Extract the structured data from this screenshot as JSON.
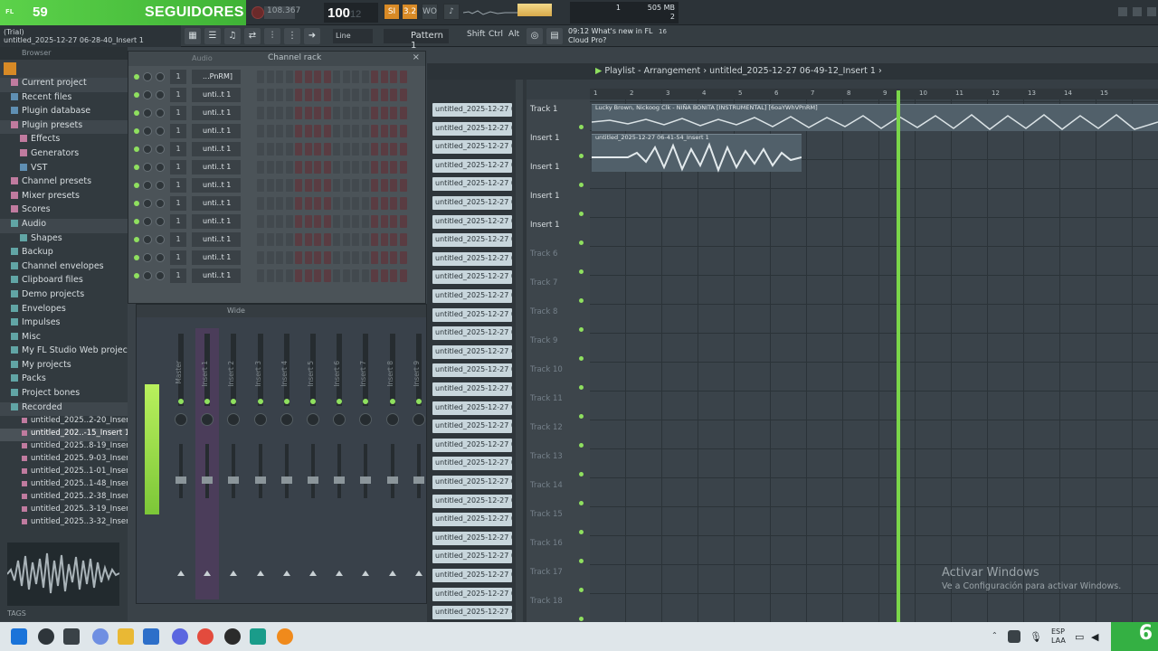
{
  "overlay": {
    "number": "59",
    "label": "SEGUIDORES",
    "app_badge": "FL"
  },
  "toolbar": {
    "tempo": "108.367",
    "time_main": "100",
    "time_sub": "12",
    "buttons": [
      "SI",
      "3.2",
      "WO"
    ],
    "cpu_value": "1",
    "memory": "505 MB",
    "voices": "2"
  },
  "hint": {
    "line1": "(Trial)",
    "line2": "untitled_2025-12-27 06-28-40_Insert 1"
  },
  "bar2": {
    "snap": "Line",
    "pattern": "Pattern 1",
    "modifiers": [
      "Shift",
      "Ctrl",
      "Alt"
    ],
    "news_time": "09:12",
    "news_line1": "What's new in FL",
    "news_line2": "Cloud Pro?",
    "news_badge": "16"
  },
  "browser": {
    "header": "Browser",
    "items": [
      {
        "label": "Current project",
        "cls": "hl",
        "icon": "pink"
      },
      {
        "label": "Recent files",
        "cls": "",
        "icon": "blue"
      },
      {
        "label": "Plugin database",
        "cls": "",
        "icon": "blue"
      },
      {
        "label": "Plugin presets",
        "cls": "hl",
        "icon": "pink"
      },
      {
        "label": "Effects",
        "cls": "sub",
        "icon": "pink"
      },
      {
        "label": "Generators",
        "cls": "sub",
        "icon": "pink"
      },
      {
        "label": "VST",
        "cls": "sub",
        "icon": "blue"
      },
      {
        "label": "Channel presets",
        "cls": "",
        "icon": "pink"
      },
      {
        "label": "Mixer presets",
        "cls": "",
        "icon": "pink"
      },
      {
        "label": "Scores",
        "cls": "",
        "icon": "pink"
      },
      {
        "label": "Audio",
        "cls": "hl",
        "icon": "teal"
      },
      {
        "label": "Shapes",
        "cls": "sub",
        "icon": "teal"
      },
      {
        "label": "Backup",
        "cls": "",
        "icon": "teal"
      },
      {
        "label": "Channel envelopes",
        "cls": "",
        "icon": "teal"
      },
      {
        "label": "Clipboard files",
        "cls": "",
        "icon": "teal"
      },
      {
        "label": "Demo projects",
        "cls": "",
        "icon": "teal"
      },
      {
        "label": "Envelopes",
        "cls": "",
        "icon": "teal"
      },
      {
        "label": "Impulses",
        "cls": "",
        "icon": "teal"
      },
      {
        "label": "Misc",
        "cls": "",
        "icon": "teal"
      },
      {
        "label": "My FL Studio Web projects",
        "cls": "",
        "icon": "teal"
      },
      {
        "label": "My projects",
        "cls": "",
        "icon": "teal"
      },
      {
        "label": "Packs",
        "cls": "",
        "icon": "teal"
      },
      {
        "label": "Project bones",
        "cls": "",
        "icon": "teal"
      },
      {
        "label": "Recorded",
        "cls": "hl",
        "icon": "teal"
      }
    ],
    "recorded": [
      {
        "label": "untitled_2025..2-20_Insert 1",
        "sel": false
      },
      {
        "label": "untitled_202..-15_Insert 1",
        "sel": true
      },
      {
        "label": "untitled_2025..8-19_Insert 1",
        "sel": false
      },
      {
        "label": "untitled_2025..9-03_Insert 1",
        "sel": false
      },
      {
        "label": "untitled_2025..1-01_Insert 1",
        "sel": false
      },
      {
        "label": "untitled_2025..1-48_Insert 1",
        "sel": false
      },
      {
        "label": "untitled_2025..2-38_Insert 1",
        "sel": false
      },
      {
        "label": "untitled_2025..3-19_Insert 1",
        "sel": false
      },
      {
        "label": "untitled_2025..3-32_Insert 1",
        "sel": false
      }
    ],
    "tags_label": "TAGS"
  },
  "rack": {
    "title": "Channel rack",
    "group": "Audio",
    "channels": [
      {
        "num": "1",
        "name": "...PnRM]"
      },
      {
        "num": "1",
        "name": "unti..t 1"
      },
      {
        "num": "1",
        "name": "unti..t 1"
      },
      {
        "num": "1",
        "name": "unti..t 1"
      },
      {
        "num": "1",
        "name": "unti..t 1"
      },
      {
        "num": "1",
        "name": "unti..t 1"
      },
      {
        "num": "1",
        "name": "unti..t 1"
      },
      {
        "num": "1",
        "name": "unti..t 1"
      },
      {
        "num": "1",
        "name": "unti..t 1"
      },
      {
        "num": "1",
        "name": "unti..t 1"
      },
      {
        "num": "1",
        "name": "unti..t 1"
      },
      {
        "num": "1",
        "name": "unti..t 1"
      }
    ]
  },
  "mixer": {
    "mode": "Wide",
    "strips": [
      "Master",
      "Insert 1",
      "Insert 2",
      "Insert 3",
      "Insert 4",
      "Insert 5",
      "Insert 6",
      "Insert 7",
      "Insert 8",
      "Insert 9"
    ],
    "numbers": [
      "C",
      "M",
      "1",
      "2",
      "3",
      "4",
      "5",
      "6",
      "7",
      "8",
      "9"
    ]
  },
  "playlist": {
    "title_prefix": "Playlist - Arrangement",
    "title_file": "untitled_2025-12-27 06-49-12_Insert 1",
    "patterns": [
      "untitled_2025-12-27 06-...",
      "untitled_2025-12-27 06-...",
      "untitled_2025-12-27 06-...",
      "untitled_2025-12-27 06-...",
      "untitled_2025-12-27 06-...",
      "untitled_2025-12-27 06-...",
      "untitled_2025-12-27 06-...",
      "untitled_2025-12-27 06-...",
      "untitled_2025-12-27 06-...",
      "untitled_2025-12-27 06-...",
      "untitled_2025-12-27 06-...",
      "untitled_2025-12-27 06-...",
      "untitled_2025-12-27 06-...",
      "untitled_2025-12-27 06-...",
      "untitled_2025-12-27 06-...",
      "untitled_2025-12-27 06-...",
      "untitled_2025-12-27 06-...",
      "untitled_2025-12-27 06-...",
      "untitled_2025-12-27 06-...",
      "untitled_2025-12-27 06-...",
      "untitled_2025-12-27 06-...",
      "untitled_2025-12-27 06-...",
      "untitled_2025-12-27 06-...",
      "untitled_2025-12-27 06-...",
      "untitled_2025-12-27 06-...",
      "untitled_2025-12-27 06-...",
      "untitled_2025-12-27 06-...",
      "untitled_2025-12-27 06-..."
    ],
    "tracks": [
      {
        "label": "Track 1",
        "dim": false
      },
      {
        "label": "Insert 1",
        "dim": false
      },
      {
        "label": "Insert 1",
        "dim": false
      },
      {
        "label": "Insert 1",
        "dim": false
      },
      {
        "label": "Insert 1",
        "dim": false
      },
      {
        "label": "Track 6",
        "dim": true
      },
      {
        "label": "Track 7",
        "dim": true
      },
      {
        "label": "Track 8",
        "dim": true
      },
      {
        "label": "Track 9",
        "dim": true
      },
      {
        "label": "Track 10",
        "dim": true
      },
      {
        "label": "Track 11",
        "dim": true
      },
      {
        "label": "Track 12",
        "dim": true
      },
      {
        "label": "Track 13",
        "dim": true
      },
      {
        "label": "Track 14",
        "dim": true
      },
      {
        "label": "Track 15",
        "dim": true
      },
      {
        "label": "Track 16",
        "dim": true
      },
      {
        "label": "Track 17",
        "dim": true
      },
      {
        "label": "Track 18",
        "dim": true
      }
    ],
    "ruler": [
      "1",
      "2",
      "3",
      "4",
      "5",
      "6",
      "7",
      "8",
      "9",
      "10",
      "11",
      "12",
      "13",
      "14",
      "15"
    ],
    "clip1_label": "Lucky Brown, Nickoog Clk - NIÑA BONITA [INSTRUMENTAL] [6oaYWhVPnRM]",
    "clip2_label": "untitled_2025-12-27 06-41-54_Insert 1"
  },
  "watermark": {
    "line1": "Activar Windows",
    "line2": "Ve a Configuración para activar Windows."
  },
  "taskbar": {
    "lang1": "ESP",
    "lang2": "LAA",
    "badge": "6"
  },
  "colors": {
    "accent_green": "#8fe05f",
    "overlay_green": "#4cc63e",
    "orange": "#d88a26"
  }
}
